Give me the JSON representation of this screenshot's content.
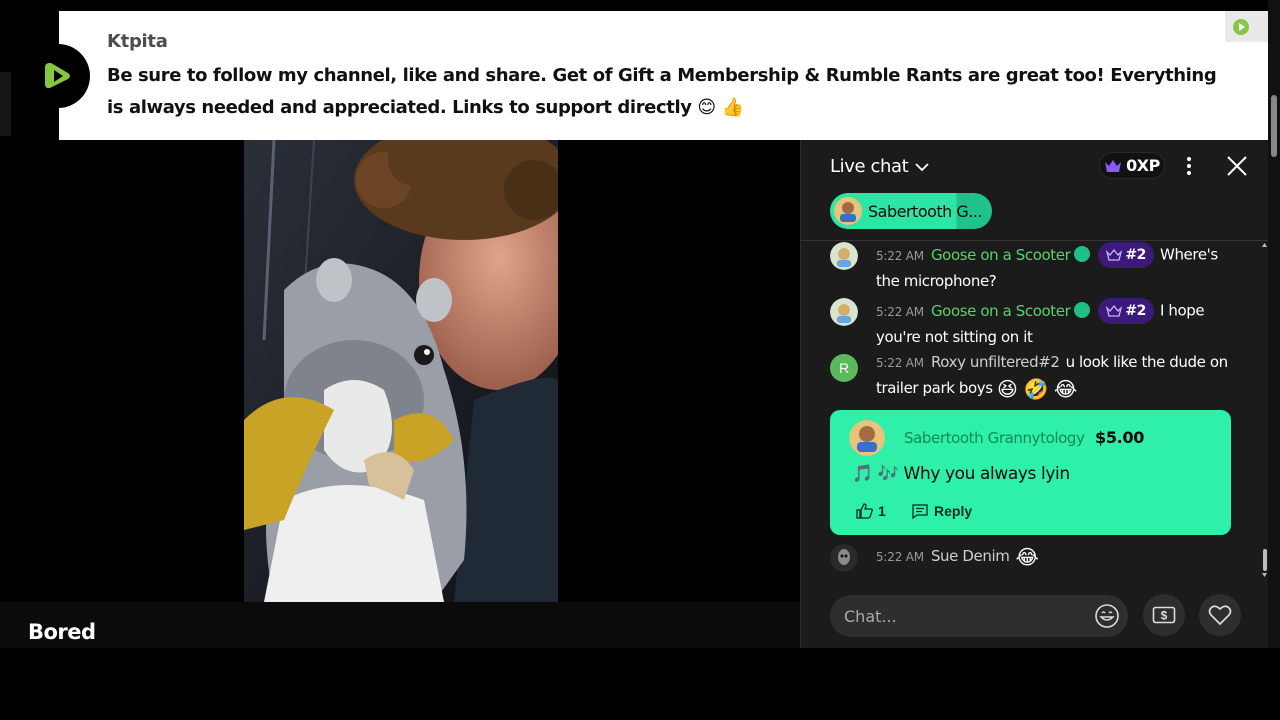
{
  "banner": {
    "author": "Ktpita",
    "message": "Be sure to follow my channel, like and share. Get of Gift a Membership & Rumble Rants are great too! Everything is always needed and appreciated. Links to support directly 😊 👍",
    "logo_icon": "rumble-logo-icon",
    "brand_color": "#85c742"
  },
  "video": {
    "title": "Bored"
  },
  "chat": {
    "title": "Live chat",
    "xp": "0XP",
    "pinned_user": "Sabertooth G...",
    "messages": [
      {
        "time": "5:22 AM",
        "user": "Goose on a Scooter",
        "rank": "#2",
        "text": "Where's the microphone?"
      },
      {
        "time": "5:22 AM",
        "user": "Goose on a Scooter",
        "rank": "#2",
        "text": "I hope you're not sitting on it"
      },
      {
        "time": "5:22 AM",
        "user": "Roxy unfiltered#2",
        "avatar_letter": "R",
        "text": "u look like the dude on trailer park boys",
        "emojis": "😆 🤣 😂"
      },
      {
        "time": "5:22 AM",
        "user": "Sue Denim",
        "text": "",
        "emojis": "😂"
      }
    ],
    "rant": {
      "user": "Sabertooth Grannytology",
      "amount": "$5.00",
      "text": "🎵 🎶 Why you always lyin",
      "likes": "1",
      "reply_label": "Reply",
      "color": "#2ff0a8"
    },
    "input_placeholder": "Chat..."
  }
}
